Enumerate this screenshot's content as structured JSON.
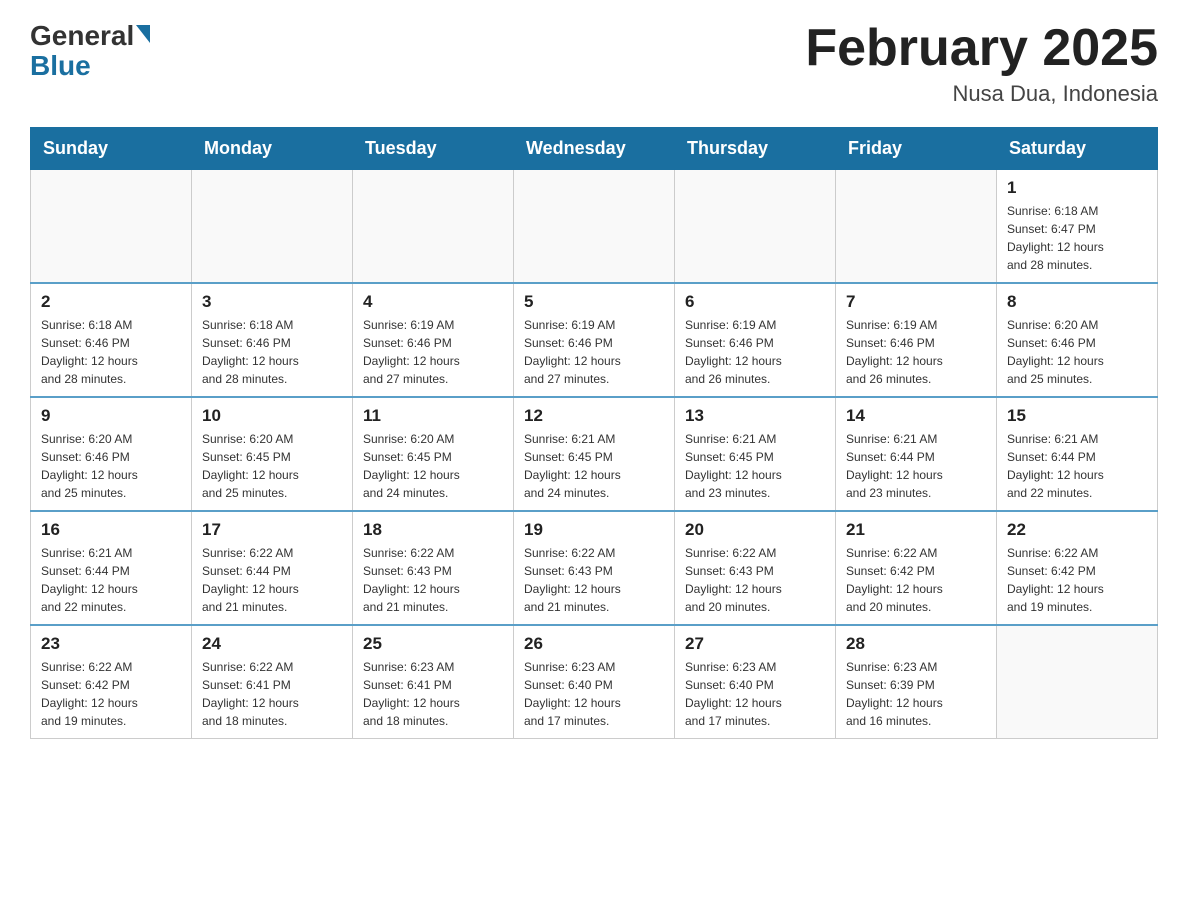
{
  "header": {
    "logo_general": "General",
    "logo_blue": "Blue",
    "month_title": "February 2025",
    "location": "Nusa Dua, Indonesia"
  },
  "weekdays": [
    "Sunday",
    "Monday",
    "Tuesday",
    "Wednesday",
    "Thursday",
    "Friday",
    "Saturday"
  ],
  "weeks": [
    [
      {
        "day": "",
        "info": ""
      },
      {
        "day": "",
        "info": ""
      },
      {
        "day": "",
        "info": ""
      },
      {
        "day": "",
        "info": ""
      },
      {
        "day": "",
        "info": ""
      },
      {
        "day": "",
        "info": ""
      },
      {
        "day": "1",
        "info": "Sunrise: 6:18 AM\nSunset: 6:47 PM\nDaylight: 12 hours\nand 28 minutes."
      }
    ],
    [
      {
        "day": "2",
        "info": "Sunrise: 6:18 AM\nSunset: 6:46 PM\nDaylight: 12 hours\nand 28 minutes."
      },
      {
        "day": "3",
        "info": "Sunrise: 6:18 AM\nSunset: 6:46 PM\nDaylight: 12 hours\nand 28 minutes."
      },
      {
        "day": "4",
        "info": "Sunrise: 6:19 AM\nSunset: 6:46 PM\nDaylight: 12 hours\nand 27 minutes."
      },
      {
        "day": "5",
        "info": "Sunrise: 6:19 AM\nSunset: 6:46 PM\nDaylight: 12 hours\nand 27 minutes."
      },
      {
        "day": "6",
        "info": "Sunrise: 6:19 AM\nSunset: 6:46 PM\nDaylight: 12 hours\nand 26 minutes."
      },
      {
        "day": "7",
        "info": "Sunrise: 6:19 AM\nSunset: 6:46 PM\nDaylight: 12 hours\nand 26 minutes."
      },
      {
        "day": "8",
        "info": "Sunrise: 6:20 AM\nSunset: 6:46 PM\nDaylight: 12 hours\nand 25 minutes."
      }
    ],
    [
      {
        "day": "9",
        "info": "Sunrise: 6:20 AM\nSunset: 6:46 PM\nDaylight: 12 hours\nand 25 minutes."
      },
      {
        "day": "10",
        "info": "Sunrise: 6:20 AM\nSunset: 6:45 PM\nDaylight: 12 hours\nand 25 minutes."
      },
      {
        "day": "11",
        "info": "Sunrise: 6:20 AM\nSunset: 6:45 PM\nDaylight: 12 hours\nand 24 minutes."
      },
      {
        "day": "12",
        "info": "Sunrise: 6:21 AM\nSunset: 6:45 PM\nDaylight: 12 hours\nand 24 minutes."
      },
      {
        "day": "13",
        "info": "Sunrise: 6:21 AM\nSunset: 6:45 PM\nDaylight: 12 hours\nand 23 minutes."
      },
      {
        "day": "14",
        "info": "Sunrise: 6:21 AM\nSunset: 6:44 PM\nDaylight: 12 hours\nand 23 minutes."
      },
      {
        "day": "15",
        "info": "Sunrise: 6:21 AM\nSunset: 6:44 PM\nDaylight: 12 hours\nand 22 minutes."
      }
    ],
    [
      {
        "day": "16",
        "info": "Sunrise: 6:21 AM\nSunset: 6:44 PM\nDaylight: 12 hours\nand 22 minutes."
      },
      {
        "day": "17",
        "info": "Sunrise: 6:22 AM\nSunset: 6:44 PM\nDaylight: 12 hours\nand 21 minutes."
      },
      {
        "day": "18",
        "info": "Sunrise: 6:22 AM\nSunset: 6:43 PM\nDaylight: 12 hours\nand 21 minutes."
      },
      {
        "day": "19",
        "info": "Sunrise: 6:22 AM\nSunset: 6:43 PM\nDaylight: 12 hours\nand 21 minutes."
      },
      {
        "day": "20",
        "info": "Sunrise: 6:22 AM\nSunset: 6:43 PM\nDaylight: 12 hours\nand 20 minutes."
      },
      {
        "day": "21",
        "info": "Sunrise: 6:22 AM\nSunset: 6:42 PM\nDaylight: 12 hours\nand 20 minutes."
      },
      {
        "day": "22",
        "info": "Sunrise: 6:22 AM\nSunset: 6:42 PM\nDaylight: 12 hours\nand 19 minutes."
      }
    ],
    [
      {
        "day": "23",
        "info": "Sunrise: 6:22 AM\nSunset: 6:42 PM\nDaylight: 12 hours\nand 19 minutes."
      },
      {
        "day": "24",
        "info": "Sunrise: 6:22 AM\nSunset: 6:41 PM\nDaylight: 12 hours\nand 18 minutes."
      },
      {
        "day": "25",
        "info": "Sunrise: 6:23 AM\nSunset: 6:41 PM\nDaylight: 12 hours\nand 18 minutes."
      },
      {
        "day": "26",
        "info": "Sunrise: 6:23 AM\nSunset: 6:40 PM\nDaylight: 12 hours\nand 17 minutes."
      },
      {
        "day": "27",
        "info": "Sunrise: 6:23 AM\nSunset: 6:40 PM\nDaylight: 12 hours\nand 17 minutes."
      },
      {
        "day": "28",
        "info": "Sunrise: 6:23 AM\nSunset: 6:39 PM\nDaylight: 12 hours\nand 16 minutes."
      },
      {
        "day": "",
        "info": ""
      }
    ]
  ]
}
